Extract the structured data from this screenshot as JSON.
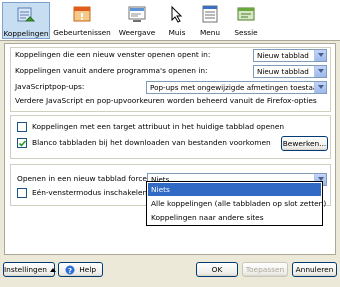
{
  "toolbar": {
    "items": [
      {
        "label": "Koppelingen",
        "icon": "links-icon"
      },
      {
        "label": "Gebeurtenissen",
        "icon": "events-icon"
      },
      {
        "label": "Weergave",
        "icon": "display-icon"
      },
      {
        "label": "Muis",
        "icon": "mouse-icon"
      },
      {
        "label": "Menu",
        "icon": "menu-icon"
      },
      {
        "label": "Sessie",
        "icon": "session-icon"
      }
    ]
  },
  "links_group": {
    "new_window_label": "Koppelingen die een nieuw venster openen opent in:",
    "new_window_value": "Nieuw tabblad",
    "other_programs_label": "Koppelingen vanuit andere programma's openen in:",
    "other_programs_value": "Nieuw tabblad",
    "js_popups_label": "JavaScriptpop-ups:",
    "js_popups_value": "Pop-ups met ongewijzigde afmetingen toestaan",
    "note": "Verdere JavaScript en pop-upvoorkeuren worden beheerd vanuit de Firefox-opties"
  },
  "options_group": {
    "target_attr_label": "Koppelingen met een target attribuut in het huidige tabblad openen",
    "target_attr_checked": false,
    "blank_tabs_label": "Blanco tabbladen bij het downloaden van bestanden voorkomen",
    "blank_tabs_checked": true,
    "edit_button": "Bewerken..."
  },
  "force_group": {
    "force_label": "Openen in een nieuw tabblad forceren:",
    "force_value": "Niets",
    "single_window_label": "Eén-venstermodus inschakelen",
    "single_window_checked": false
  },
  "dropdown": {
    "options": [
      "Niets",
      "Alle koppelingen (alle tabbladen op slot zetten)",
      "Koppelingen naar andere sites"
    ],
    "selected": "Niets"
  },
  "footer": {
    "settings_button": "Instellingen",
    "help_button": "Help",
    "ok_button": "OK",
    "apply_button": "Toepassen",
    "cancel_button": "Annuleren"
  }
}
